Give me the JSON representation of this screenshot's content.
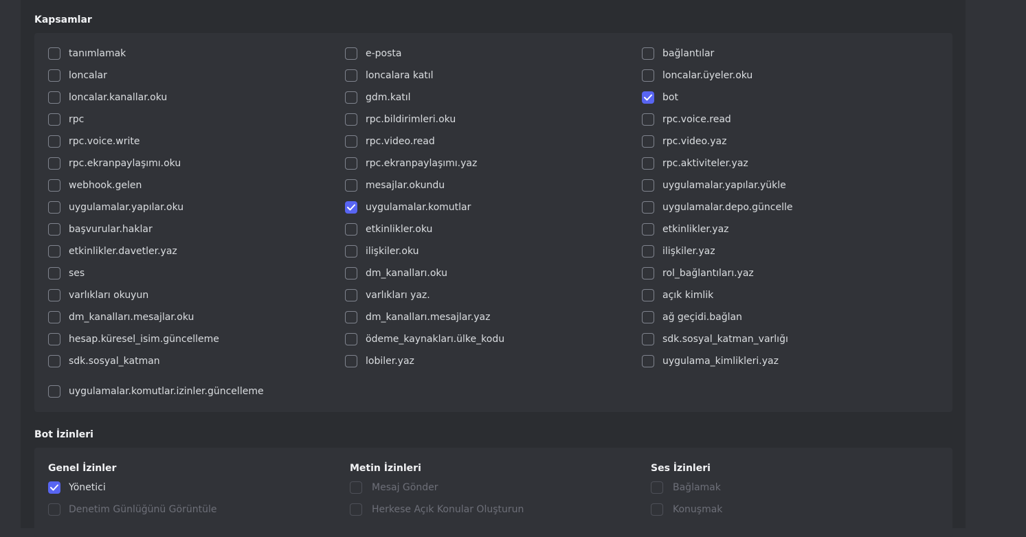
{
  "scopes": {
    "title": "Kapsamlar",
    "columns": [
      [
        {
          "label": "tanımlamak",
          "checked": false
        },
        {
          "label": "loncalar",
          "checked": false
        },
        {
          "label": "loncalar.kanallar.oku",
          "checked": false
        },
        {
          "label": "rpc",
          "checked": false
        },
        {
          "label": "rpc.voice.write",
          "checked": false
        },
        {
          "label": "rpc.ekranpaylaşımı.oku",
          "checked": false
        },
        {
          "label": "webhook.gelen",
          "checked": false
        },
        {
          "label": "uygulamalar.yapılar.oku",
          "checked": false
        },
        {
          "label": "başvurular.haklar",
          "checked": false
        },
        {
          "label": "etkinlikler.davetler.yaz",
          "checked": false
        },
        {
          "label": "ses",
          "checked": false
        },
        {
          "label": "varlıkları okuyun",
          "checked": false
        },
        {
          "label": "dm_kanalları.mesajlar.oku",
          "checked": false
        },
        {
          "label": "hesap.küresel_isim.güncelleme",
          "checked": false
        },
        {
          "label": "sdk.sosyal_katman",
          "checked": false
        }
      ],
      [
        {
          "label": "e-posta",
          "checked": false
        },
        {
          "label": "loncalara katıl",
          "checked": false
        },
        {
          "label": "gdm.katıl",
          "checked": false
        },
        {
          "label": "rpc.bildirimleri.oku",
          "checked": false
        },
        {
          "label": "rpc.video.read",
          "checked": false
        },
        {
          "label": "rpc.ekranpaylaşımı.yaz",
          "checked": false
        },
        {
          "label": "mesajlar.okundu",
          "checked": false
        },
        {
          "label": "uygulamalar.komutlar",
          "checked": true
        },
        {
          "label": "etkinlikler.oku",
          "checked": false
        },
        {
          "label": "ilişkiler.oku",
          "checked": false
        },
        {
          "label": "dm_kanalları.oku",
          "checked": false
        },
        {
          "label": "varlıkları yaz.",
          "checked": false
        },
        {
          "label": "dm_kanalları.mesajlar.yaz",
          "checked": false
        },
        {
          "label": "ödeme_kaynakları.ülke_kodu",
          "checked": false
        },
        {
          "label": "lobiler.yaz",
          "checked": false
        }
      ],
      [
        {
          "label": "bağlantılar",
          "checked": false
        },
        {
          "label": "loncalar.üyeler.oku",
          "checked": false
        },
        {
          "label": "bot",
          "checked": true
        },
        {
          "label": "rpc.voice.read",
          "checked": false
        },
        {
          "label": "rpc.video.yaz",
          "checked": false
        },
        {
          "label": "rpc.aktiviteler.yaz",
          "checked": false
        },
        {
          "label": "uygulamalar.yapılar.yükle",
          "checked": false
        },
        {
          "label": "uygulamalar.depo.güncelle",
          "checked": false
        },
        {
          "label": "etkinlikler.yaz",
          "checked": false
        },
        {
          "label": "ilişkiler.yaz",
          "checked": false
        },
        {
          "label": "rol_bağlantıları.yaz",
          "checked": false
        },
        {
          "label": "açık kimlik",
          "checked": false
        },
        {
          "label": "ağ geçidi.bağlan",
          "checked": false
        },
        {
          "label": "sdk.sosyal_katman_varlığı",
          "checked": false
        },
        {
          "label": "uygulama_kimlikleri.yaz",
          "checked": false
        }
      ]
    ],
    "extra": {
      "label": "uygulamalar.komutlar.izinler.güncelleme",
      "checked": false
    }
  },
  "bot_permissions": {
    "title": "Bot İzinleri",
    "groups": [
      {
        "heading": "Genel İzinler",
        "items": [
          {
            "label": "Yönetici",
            "checked": true,
            "disabled": false
          },
          {
            "label": "Denetim Günlüğünü Görüntüle",
            "checked": false,
            "disabled": true
          }
        ]
      },
      {
        "heading": "Metin İzinleri",
        "items": [
          {
            "label": "Mesaj Gönder",
            "checked": false,
            "disabled": true
          },
          {
            "label": "Herkese Açık Konular Oluşturun",
            "checked": false,
            "disabled": true
          }
        ]
      },
      {
        "heading": "Ses İzinleri",
        "items": [
          {
            "label": "Bağlamak",
            "checked": false,
            "disabled": true
          },
          {
            "label": "Konuşmak",
            "checked": false,
            "disabled": true
          }
        ]
      }
    ]
  },
  "colors": {
    "accent": "#5865f2",
    "panel": "#2b2d31",
    "box": "#313338"
  },
  "icons": {
    "check": "checkmark-icon"
  }
}
